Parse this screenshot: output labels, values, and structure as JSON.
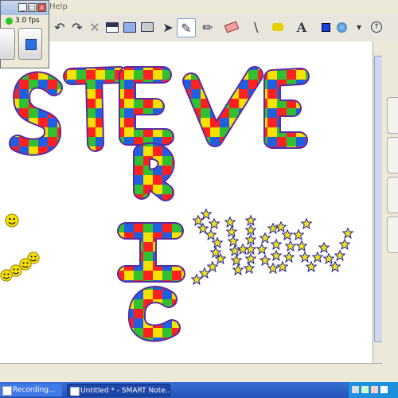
{
  "menubar": {
    "help": "Help"
  },
  "recorder": {
    "fps": "3.0 fps"
  },
  "taskbar": {
    "recording": "Recording...",
    "notebook": "Untitled * - SMART Note..."
  },
  "toolbar": {
    "icons": [
      "undo-icon",
      "redo-icon",
      "delete-icon",
      "screen-shade-icon",
      "full-screen-icon",
      "capture-icon",
      "select-arrow-icon",
      "pen-icon",
      "creative-pen-icon",
      "eraser-icon",
      "line-icon",
      "fill-icon",
      "text-icon",
      "color-icon",
      "properties-icon",
      "more-icon"
    ],
    "text_tool": "A"
  },
  "drawing": {
    "words": [
      "STEVE",
      "ERIC",
      "SHOW"
    ],
    "word_styles": [
      "rainbow-marker",
      "rainbow-marker",
      "star-stamp"
    ],
    "letter_colors": [
      "#ff2020",
      "#ffa000",
      "#f5e000",
      "#30c030",
      "#2060e0",
      "#8a2be2"
    ],
    "star_color": "#f2e21a",
    "star_outline": "#1a1aa0",
    "smiley_color": "#f5e000"
  }
}
